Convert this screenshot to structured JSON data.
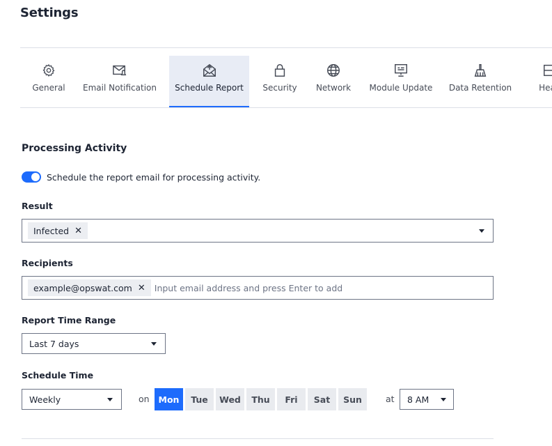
{
  "page": {
    "title": "Settings"
  },
  "tabs": [
    {
      "label": "General",
      "icon": "gear-icon"
    },
    {
      "label": "Email Notification",
      "icon": "mail-notification-icon"
    },
    {
      "label": "Schedule Report",
      "icon": "mail-open-icon",
      "active": true
    },
    {
      "label": "Security",
      "icon": "lock-icon"
    },
    {
      "label": "Network",
      "icon": "globe-icon"
    },
    {
      "label": "Module Update",
      "icon": "module-update-icon"
    },
    {
      "label": "Data Retention",
      "icon": "broom-icon"
    },
    {
      "label": "Healt",
      "icon": "health-icon"
    }
  ],
  "section": {
    "title": "Processing Activity",
    "toggle_label": "Schedule the report email for processing activity.",
    "toggle_on": true
  },
  "result": {
    "label": "Result",
    "chips": [
      "Infected"
    ]
  },
  "recipients": {
    "label": "Recipients",
    "chips": [
      "example@opswat.com"
    ],
    "placeholder": "Input email address and press Enter to add"
  },
  "time_range": {
    "label": "Report Time Range",
    "value": "Last 7 days"
  },
  "schedule": {
    "label": "Schedule Time",
    "frequency": "Weekly",
    "on_label": "on",
    "days": [
      "Mon",
      "Tue",
      "Wed",
      "Thu",
      "Fri",
      "Sat",
      "Sun"
    ],
    "selected_day": "Mon",
    "at_label": "at",
    "hour": "8 AM"
  },
  "colors": {
    "accent": "#1d6bfc",
    "active_tab_bg": "#e8ecf5",
    "chip_bg": "#eceef2",
    "text": "#1d2433"
  }
}
